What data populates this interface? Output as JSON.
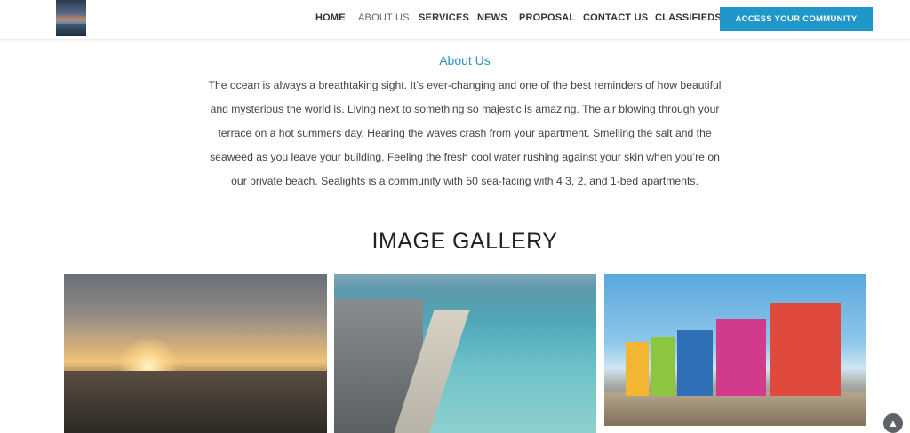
{
  "header": {
    "logo_icon": "logo-icon",
    "nav": [
      {
        "label": "HOME",
        "active": false
      },
      {
        "label": "ABOUT US",
        "active": true
      },
      {
        "label": "SERVICES",
        "active": false
      },
      {
        "label": "NEWS",
        "active": false
      },
      {
        "label": "PROPOSAL",
        "active": false
      },
      {
        "label": "CONTACT US",
        "active": false
      },
      {
        "label": "CLASSIFIEDS",
        "active": false
      }
    ],
    "cta_label": "ACCESS YOUR COMMUNITY"
  },
  "about": {
    "title": "About Us",
    "lines": [
      "The ocean is always a breathtaking sight. It’s ever-changing and one of the best reminders of how beautiful",
      "and mysterious the world is. Living next to something so majestic is amazing. The air blowing through your",
      "terrace on a hot summers day. Hearing the waves crash from your apartment. Smelling the salt and the",
      "seaweed as you leave your building. Feeling the fresh cool water rushing against your skin when you’re on",
      "our private beach.  Sealights is a community with 50 sea-facing with 4 3, 2, and 1-bed apartments."
    ]
  },
  "gallery": {
    "title": "IMAGE GALLERY",
    "images": [
      "sunset-city-image",
      "coastal-city-aerial-image",
      "colorful-beach-huts-image"
    ]
  },
  "scroll_top_icon": "chevron-up-icon",
  "colors": {
    "accent": "#2a93c4",
    "cta": "#1f97c8"
  }
}
